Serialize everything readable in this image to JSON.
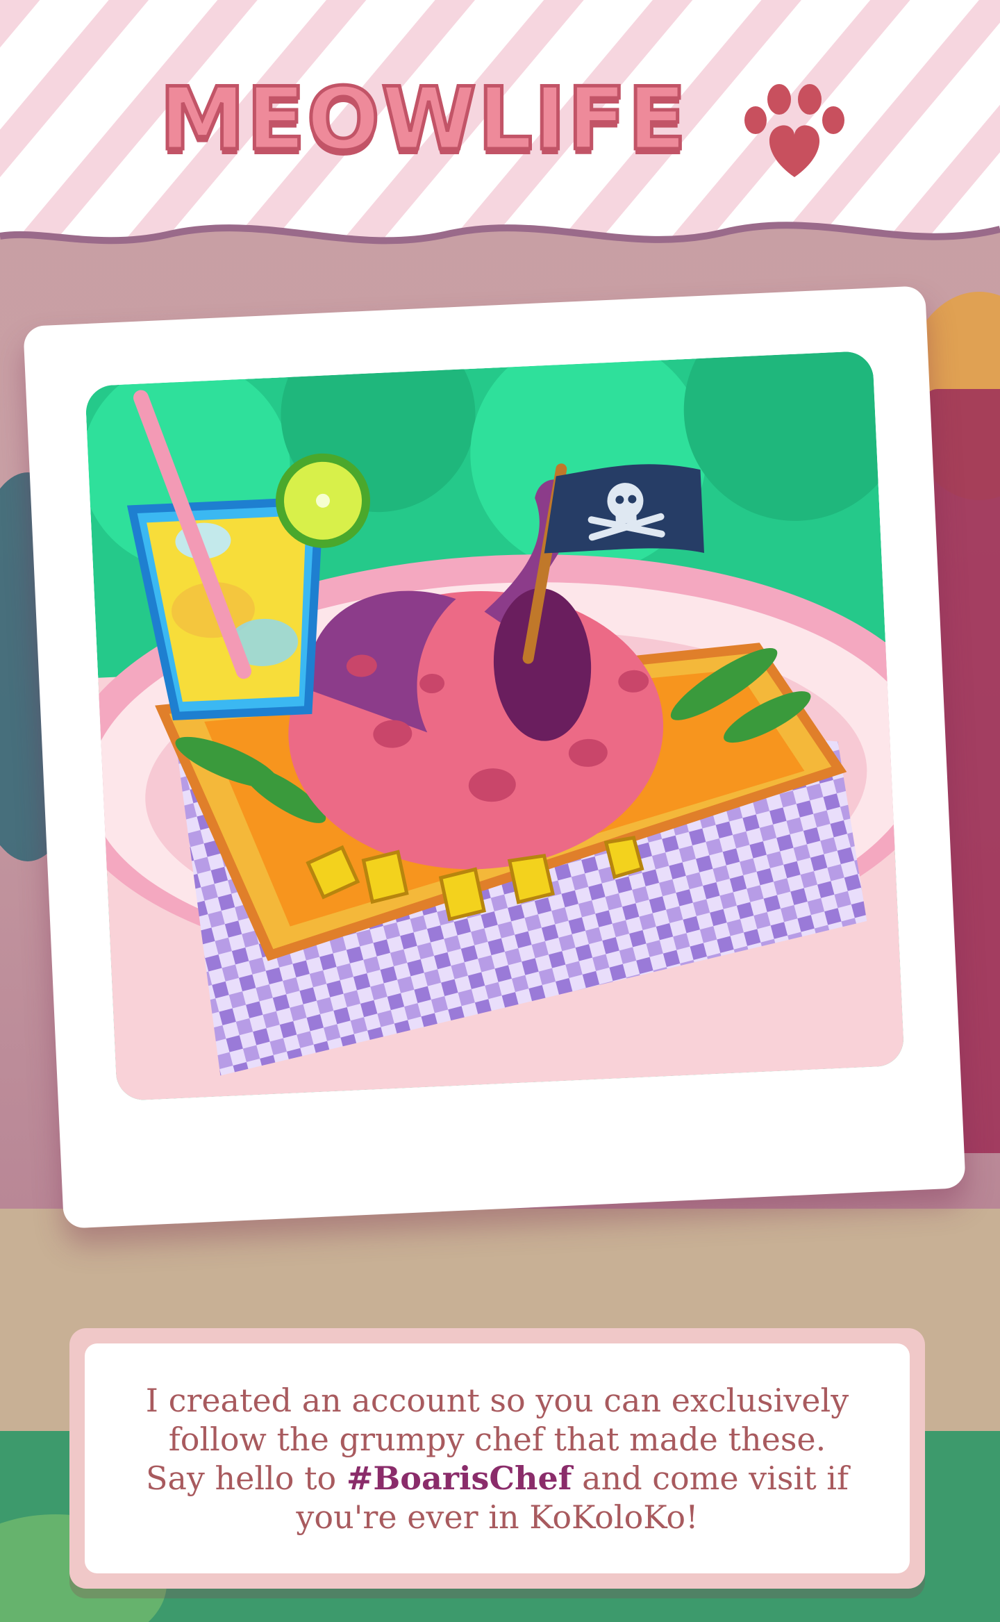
{
  "app": {
    "logo_text": "MEOWLIFE",
    "logo_icon": "paw-heart-icon"
  },
  "photo": {
    "image_icon": "octopus-dish-photo",
    "flag_icon": "pirate-flag-icon"
  },
  "caption": {
    "text_before": "I created an account so you can exclusively follow the grumpy chef that made these. Say hello to ",
    "hashtag": "#BoarisChef",
    "text_after": " and come visit if you're ever in KoKoloKo!"
  },
  "colors": {
    "logo_fill": "#ee8a9a",
    "logo_outline": "#c25467",
    "caption_text": "#a85a5e",
    "hashtag": "#8a2c6a",
    "caption_frame": "#f0c8c8"
  }
}
